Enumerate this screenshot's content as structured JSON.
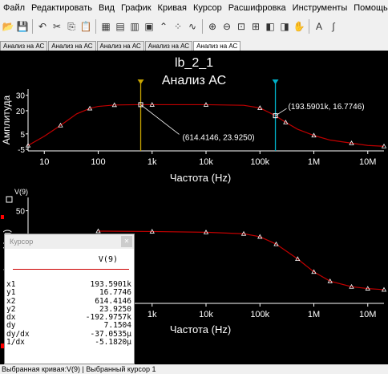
{
  "menu": [
    "Файл",
    "Редактировать",
    "Вид",
    "График",
    "Кривая",
    "Курсор",
    "Расшифровка",
    "Инструменты",
    "Помощь"
  ],
  "toolbar_icons": [
    "open-icon",
    "save-icon",
    "undo-icon",
    "cut-icon",
    "copy-icon",
    "paste-icon",
    "grid-icon",
    "table-icon",
    "chart-icon",
    "plot-icon",
    "peak-icon",
    "dots-icon",
    "wave-icon",
    "zoom-in-icon",
    "zoom-out-icon",
    "zoom-fit-icon",
    "zoom-area-icon",
    "zoom-prev-icon",
    "zoom-next-icon",
    "pan-icon",
    "text-icon",
    "formula-icon"
  ],
  "tabs": [
    "Анализ на АС",
    "Анализ на АС",
    "Анализ на АС",
    "Анализ на АС",
    "Анализ на АС"
  ],
  "colors": {
    "curve": "#c00000",
    "cursor1": "#c8a400",
    "cursor2": "#00b0c8",
    "axis": "#ffffff",
    "grid": "#ffffff"
  },
  "chart_data": [
    {
      "type": "line",
      "title": "lb_2_1",
      "subtitle": "Анализ АС",
      "xlabel": "Частота (Hz)",
      "ylabel": "Амплитуда",
      "xscale": "log",
      "xlim": [
        5,
        20000000
      ],
      "ylim": [
        -6,
        34
      ],
      "xticks": [
        "10",
        "100",
        "1k",
        "10k",
        "100k",
        "1M",
        "10M"
      ],
      "yticks": [
        "30",
        "20",
        "5",
        "-5"
      ],
      "series": [
        {
          "x": [
            5,
            10,
            20,
            40,
            70,
            100,
            200,
            500,
            1000,
            2000,
            10000,
            50000,
            100000,
            193590,
            300000,
            500000,
            1000000,
            2000000,
            5000000,
            10000000,
            20000000
          ],
          "y": [
            -2.5,
            3.5,
            10.5,
            18,
            21.5,
            22.8,
            23.7,
            23.9,
            23.9,
            23.9,
            23.9,
            23.5,
            21.8,
            16.8,
            12.5,
            8,
            4,
            1,
            -1,
            -2.5,
            -3
          ]
        }
      ],
      "cursors": [
        {
          "x": 614.4146,
          "y": 23.925,
          "label": "(614.4146, 23.9250)"
        },
        {
          "x": 193590.1,
          "y": 16.7746,
          "label": "(193.5901k, 16.7746)"
        }
      ]
    },
    {
      "type": "line",
      "xlabel": "Частота (Hz)",
      "ylabel": "Фаза (deg)",
      "legend": [
        "V(9)"
      ],
      "xscale": "log",
      "xlim": [
        5,
        20000000
      ],
      "ylim": [
        -200,
        60
      ],
      "xticks": [
        "10",
        "100",
        "1k",
        "10k",
        "100k",
        "1M",
        "10M"
      ],
      "yticks": [
        "50"
      ],
      "series": [
        {
          "name": "V(9)",
          "x": [
            100,
            1000,
            10000,
            50000,
            100000,
            200000,
            500000,
            1000000,
            2000000,
            5000000,
            10000000,
            20000000
          ],
          "y": [
            -5,
            -6,
            -8,
            -12,
            -20,
            -40,
            -80,
            -115,
            -140,
            -155,
            -160,
            -163
          ]
        }
      ]
    }
  ],
  "cursor_panel": {
    "title": "Курсор",
    "column": "V(9)",
    "rows": [
      {
        "k": "x1",
        "v": "193.5901k"
      },
      {
        "k": "y1",
        "v": "16.7746"
      },
      {
        "k": "x2",
        "v": "614.4146"
      },
      {
        "k": "y2",
        "v": "23.9250"
      },
      {
        "k": "dx",
        "v": "-192.9757k"
      },
      {
        "k": "dy",
        "v": "7.1504"
      },
      {
        "k": "dy/dx",
        "v": "-37.0535µ"
      },
      {
        "k": "1/dx",
        "v": "-5.1820µ"
      }
    ]
  },
  "status": "Выбранная кривая:V(9)  |  Выбранный курсор 1"
}
